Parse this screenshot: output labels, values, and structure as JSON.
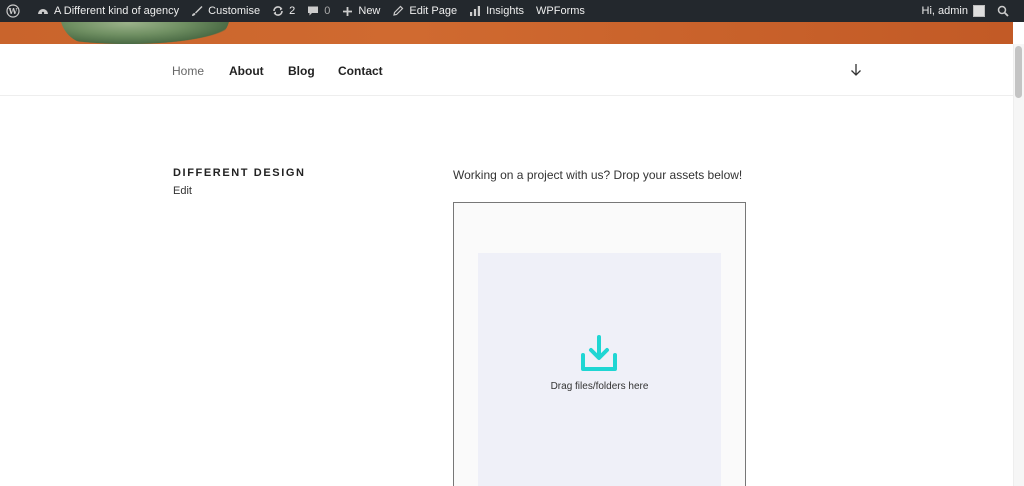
{
  "adminbar": {
    "site_name": "A Different kind of agency",
    "customise": "Customise",
    "updates_count": "2",
    "comments_count": "0",
    "new": "New",
    "edit_page": "Edit Page",
    "insights": "Insights",
    "wpforms": "WPForms",
    "greeting": "Hi, admin"
  },
  "nav": {
    "items": [
      {
        "label": "Home"
      },
      {
        "label": "About"
      },
      {
        "label": "Blog"
      },
      {
        "label": "Contact"
      }
    ]
  },
  "sidebar": {
    "title": "DIFFERENT DESIGN",
    "edit": "Edit"
  },
  "main": {
    "intro": "Working on a project with us? Drop your assets below!",
    "dropzone_label": "Drag files/folders here"
  },
  "colors": {
    "adminbar_bg": "#23282d",
    "accent_cyan": "#1fd6d3",
    "dropzone_bg": "#eff0f8"
  },
  "icons": {
    "wp_logo": "wordpress-icon",
    "dashboard": "dashboard-icon",
    "customise": "brush-icon",
    "updates": "refresh-icon",
    "comments": "comment-icon",
    "new": "plus-icon",
    "edit": "pencil-icon",
    "insights": "bar-chart-icon",
    "search": "search-icon",
    "nav_arrow": "arrow-down-icon",
    "upload": "download-tray-icon"
  }
}
